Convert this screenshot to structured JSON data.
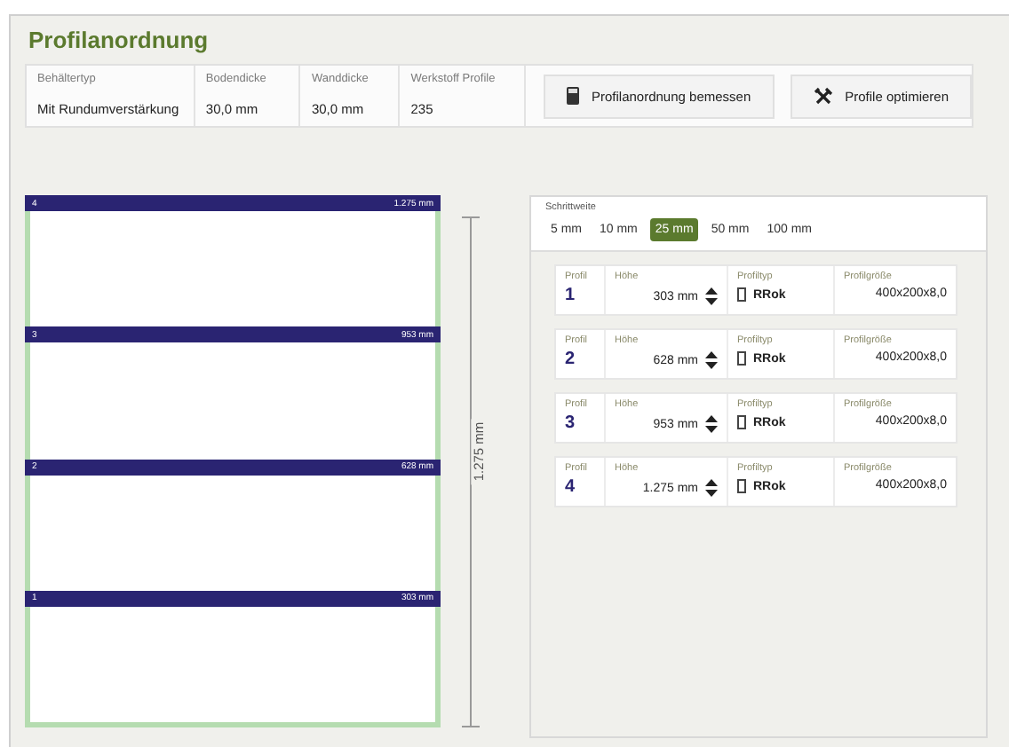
{
  "title": "Profilanordnung",
  "info": [
    {
      "label": "Behältertyp",
      "value": "Mit Rundumverstärkung"
    },
    {
      "label": "Bodendicke",
      "value": "30,0 mm"
    },
    {
      "label": "Wanddicke",
      "value": "30,0 mm"
    },
    {
      "label": "Werkstoff Profile",
      "value": "235"
    }
  ],
  "buttons": [
    {
      "kind": "calculator",
      "label": "Profilanordnung bemessen"
    },
    {
      "kind": "tools",
      "label": "Profile optimieren"
    }
  ],
  "drawing": {
    "profiles": [
      {
        "number": "4",
        "height": "1.275 mm"
      },
      {
        "number": "3",
        "height": "953 mm"
      },
      {
        "number": "2",
        "height": "628 mm"
      },
      {
        "number": "1",
        "height": "303 mm"
      }
    ],
    "dimension": "1.275 mm"
  },
  "step": {
    "label": "Schrittweite",
    "options": [
      {
        "label": "5 mm",
        "selected": false
      },
      {
        "label": "10 mm",
        "selected": false
      },
      {
        "label": "25 mm",
        "selected": true
      },
      {
        "label": "50 mm",
        "selected": false
      },
      {
        "label": "100 mm",
        "selected": false
      }
    ]
  },
  "profiles": [
    {
      "labels": [
        "Profil",
        "Höhe",
        "Profiltyp",
        "Profilgröße"
      ],
      "number": "1",
      "height": "303 mm",
      "type": "RRok",
      "size": "400x200x8,0"
    },
    {
      "labels": [
        "Profil",
        "Höhe",
        "Profiltyp",
        "Profilgröße"
      ],
      "number": "2",
      "height": "628 mm",
      "type": "RRok",
      "size": "400x200x8,0"
    },
    {
      "labels": [
        "Profil",
        "Höhe",
        "Profiltyp",
        "Profilgröße"
      ],
      "number": "3",
      "height": "953 mm",
      "type": "RRok",
      "size": "400x200x8,0"
    },
    {
      "labels": [
        "Profil",
        "Höhe",
        "Profiltyp",
        "Profilgröße"
      ],
      "number": "4",
      "height": "1.275 mm",
      "type": "RRok",
      "size": "400x200x8,0"
    }
  ]
}
